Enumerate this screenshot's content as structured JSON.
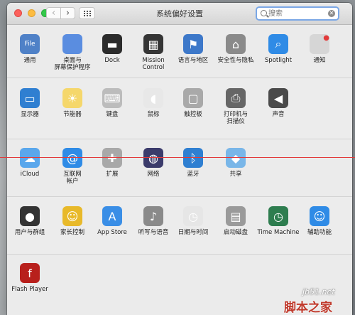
{
  "window": {
    "title": "系统偏好设置"
  },
  "search": {
    "value": "",
    "placeholder": "搜索"
  },
  "rows": [
    [
      {
        "label": "通用",
        "icon": "general-icon",
        "color": "#4f81c7"
      },
      {
        "label": "桌面与\n屏幕保护程序",
        "icon": "desktop-screensaver-icon",
        "color": "#5a8de0"
      },
      {
        "label": "Dock",
        "icon": "dock-icon",
        "color": "#2b2b2b"
      },
      {
        "label": "Mission\nControl",
        "icon": "mission-control-icon",
        "color": "#353535"
      },
      {
        "label": "语言与地区",
        "icon": "language-region-icon",
        "color": "#3d78c9"
      },
      {
        "label": "安全性与隐私",
        "icon": "security-privacy-icon",
        "color": "#8a8a8a"
      },
      {
        "label": "Spotlight",
        "icon": "spotlight-icon",
        "color": "#2f8be6"
      },
      {
        "label": "通知",
        "icon": "notifications-icon",
        "color": "#d6d6d6"
      }
    ],
    [
      {
        "label": "显示器",
        "icon": "displays-icon",
        "color": "#2f7fd1"
      },
      {
        "label": "节能器",
        "icon": "energy-saver-icon",
        "color": "#f5d76b"
      },
      {
        "label": "键盘",
        "icon": "keyboard-icon",
        "color": "#bcbcbc"
      },
      {
        "label": "鼠标",
        "icon": "mouse-icon",
        "color": "#e8e8e8"
      },
      {
        "label": "触控板",
        "icon": "trackpad-icon",
        "color": "#a9a9a9"
      },
      {
        "label": "打印机与\n扫描仪",
        "icon": "printers-scanners-icon",
        "color": "#666666"
      },
      {
        "label": "声音",
        "icon": "sound-icon",
        "color": "#4a4a4a"
      }
    ],
    [
      {
        "label": "iCloud",
        "icon": "icloud-icon",
        "color": "#5aa7ec"
      },
      {
        "label": "互联网\n帐户",
        "icon": "internet-accounts-icon",
        "color": "#2f8be6"
      },
      {
        "label": "扩展",
        "icon": "extensions-icon",
        "color": "#a8a8a8"
      },
      {
        "label": "网络",
        "icon": "network-icon",
        "color": "#3b3b6b"
      },
      {
        "label": "蓝牙",
        "icon": "bluetooth-icon",
        "color": "#2f7fd1"
      },
      {
        "label": "共享",
        "icon": "sharing-icon",
        "color": "#79b6e8"
      }
    ],
    [
      {
        "label": "用户与群组",
        "icon": "users-groups-icon",
        "color": "#333333"
      },
      {
        "label": "家长控制",
        "icon": "parental-controls-icon",
        "color": "#e8b92a"
      },
      {
        "label": "App Store",
        "icon": "app-store-icon",
        "color": "#3a8ee6"
      },
      {
        "label": "听写与语音",
        "icon": "dictation-speech-icon",
        "color": "#8a8a8a"
      },
      {
        "label": "日期与时间",
        "icon": "date-time-icon",
        "color": "#e6e6e6"
      },
      {
        "label": "启动磁盘",
        "icon": "startup-disk-icon",
        "color": "#9a9a9a"
      },
      {
        "label": "Time Machine",
        "icon": "time-machine-icon",
        "color": "#2e7d4f"
      },
      {
        "label": "辅助功能",
        "icon": "accessibility-icon",
        "color": "#2f8be6"
      }
    ],
    [
      {
        "label": "Flash Player",
        "icon": "flash-player-icon",
        "color": "#b8201c"
      }
    ]
  ],
  "glyphs": {
    "general-icon": "File",
    "dock-icon": "▬",
    "mission-control-icon": "▦",
    "language-region-icon": "⚑",
    "security-privacy-icon": "⌂",
    "spotlight-icon": "⌕",
    "displays-icon": "▭",
    "energy-saver-icon": "☀",
    "keyboard-icon": "⌨",
    "mouse-icon": "◖",
    "trackpad-icon": "▢",
    "printers-scanners-icon": "⎙",
    "sound-icon": "◀",
    "icloud-icon": "☁",
    "internet-accounts-icon": "@",
    "extensions-icon": "✚",
    "network-icon": "◍",
    "bluetooth-icon": "ᛒ",
    "sharing-icon": "◆",
    "users-groups-icon": "●",
    "parental-controls-icon": "☺",
    "app-store-icon": "A",
    "dictation-speech-icon": "♪",
    "date-time-icon": "◷",
    "startup-disk-icon": "▤",
    "time-machine-icon": "◷",
    "accessibility-icon": "☺",
    "flash-player-icon": "f",
    "notifications-icon": "●"
  },
  "watermark": {
    "site": "jb51.net",
    "name": "脚本之家"
  }
}
